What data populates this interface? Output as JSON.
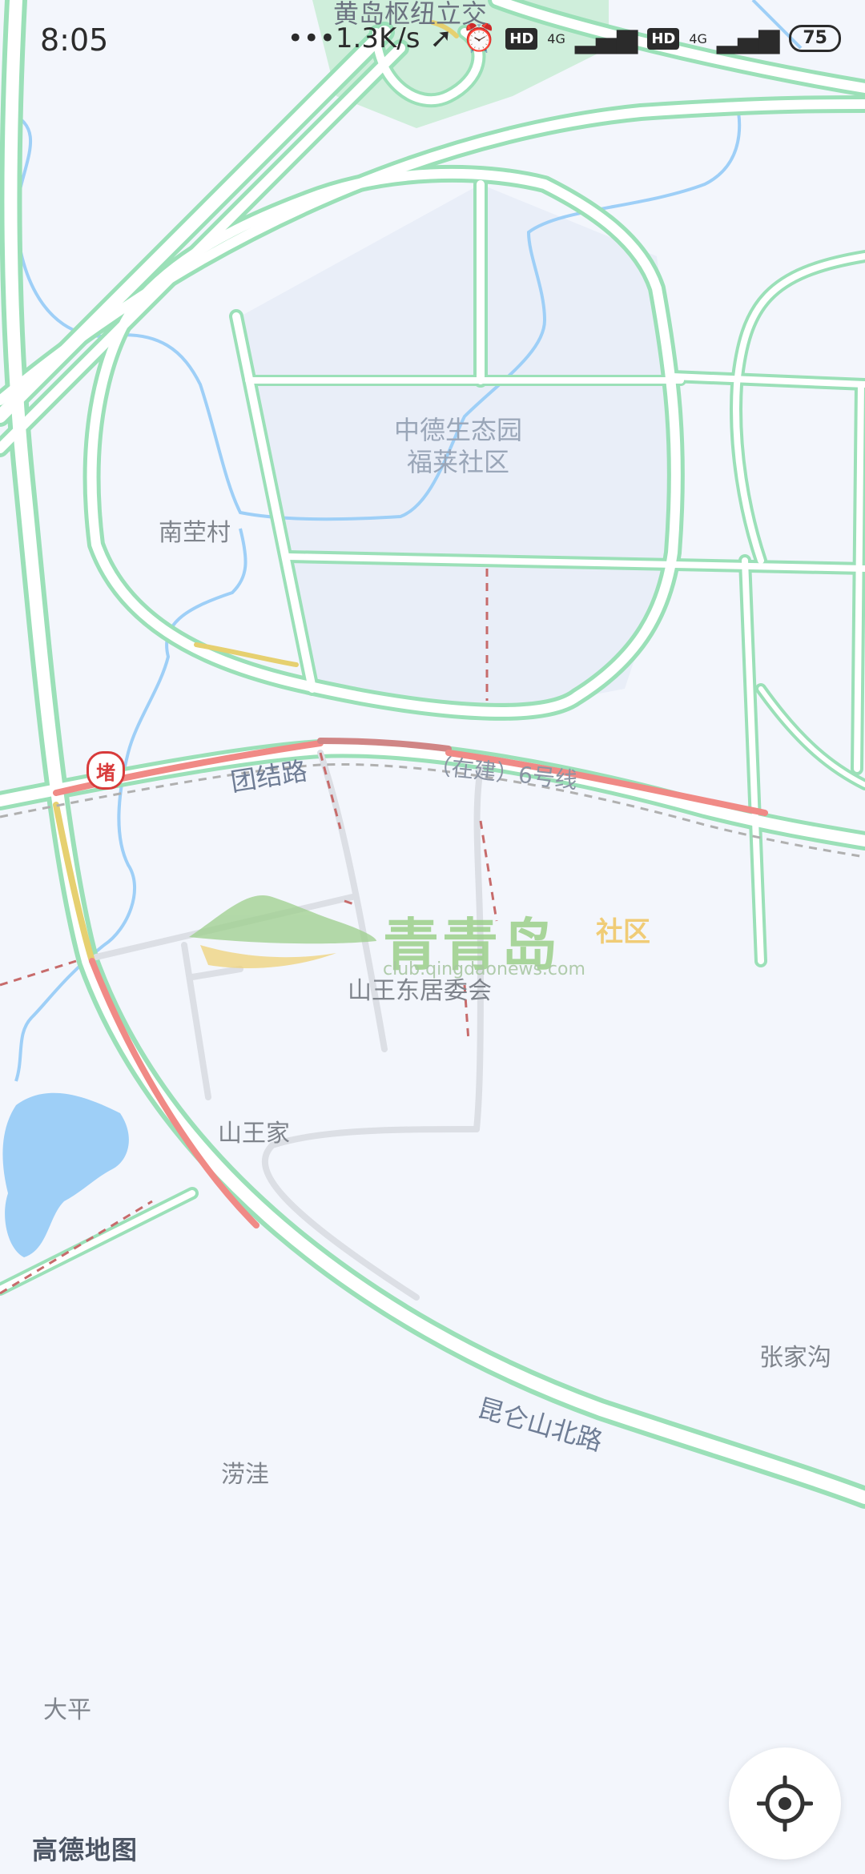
{
  "status_bar": {
    "time": "8:05",
    "network_speed": "•••1.3K/s",
    "hd_badge": "HD",
    "network_type": "4G",
    "battery": "75"
  },
  "place_labels": {
    "huangdao_interchange": "黄岛枢纽立交",
    "community_line1": "中德生态园",
    "community_line2": "福莱社区",
    "nanxing_village": "南茔村",
    "shanwang_east": "山王东居委会",
    "shanwang_home": "山王家",
    "zhangjiagou": "张家沟",
    "laowa": "涝洼",
    "daping": "大平"
  },
  "road_labels": {
    "tuanjie_road": "团结路",
    "metro_line6": "（在建）6号线",
    "kunlunshan_north": "昆仑山北路"
  },
  "traffic_icon": {
    "label": "堵",
    "icon": "traffic-jam-icon"
  },
  "watermark": {
    "title": "青青岛",
    "suffix": "社区",
    "url": "club.qingdaonews.com"
  },
  "brand": "高德地图",
  "locate_button": {
    "icon": "locate-crosshair-icon"
  },
  "colors": {
    "background": "#f3f6fc",
    "road_fill": "#ffffff",
    "road_casing": "#9be0b8",
    "water": "#9ecff7",
    "congestion_red": "#f08a86",
    "slow_yellow": "#e6d070",
    "park_area": "#e9eef8"
  }
}
